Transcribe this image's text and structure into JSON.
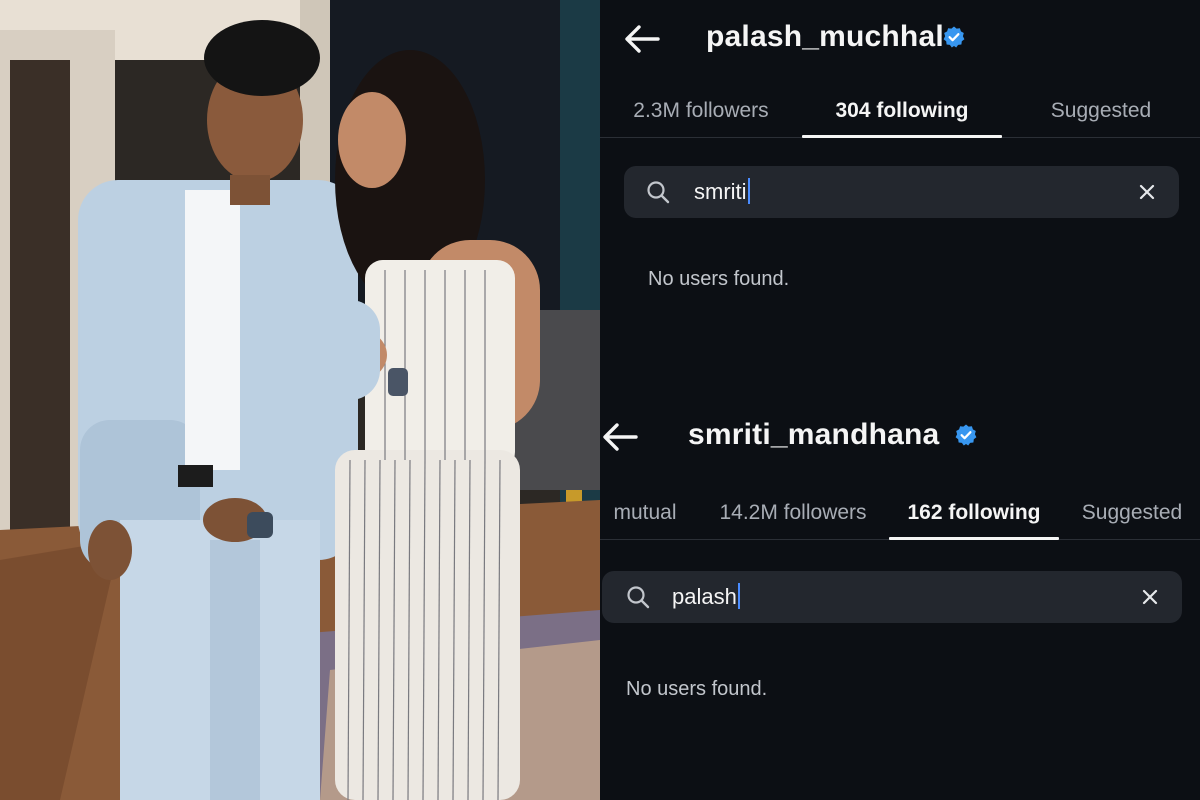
{
  "photo": {
    "description_icon": "couple-photo"
  },
  "profile_top": {
    "username": "palash_muchhal",
    "verified_icon": "verified-badge-icon",
    "tabs": [
      {
        "label": "2.3M followers"
      },
      {
        "label": "304 following"
      },
      {
        "label": "Suggested"
      }
    ],
    "active_tab": 1,
    "search_query": "smriti",
    "empty_text": "No users found."
  },
  "profile_bottom": {
    "username": "smriti_mandhana",
    "verified_icon": "verified-badge-icon",
    "tabs": [
      {
        "label": "mutual"
      },
      {
        "label": "14.2M followers"
      },
      {
        "label": "162 following"
      },
      {
        "label": "Suggested"
      }
    ],
    "active_tab": 2,
    "search_query": "palash",
    "empty_text": "No users found."
  },
  "colors": {
    "background": "#0c0f14",
    "search_bg": "#23272e",
    "verified_blue": "#3897f0",
    "caret_blue": "#4a8cff"
  }
}
